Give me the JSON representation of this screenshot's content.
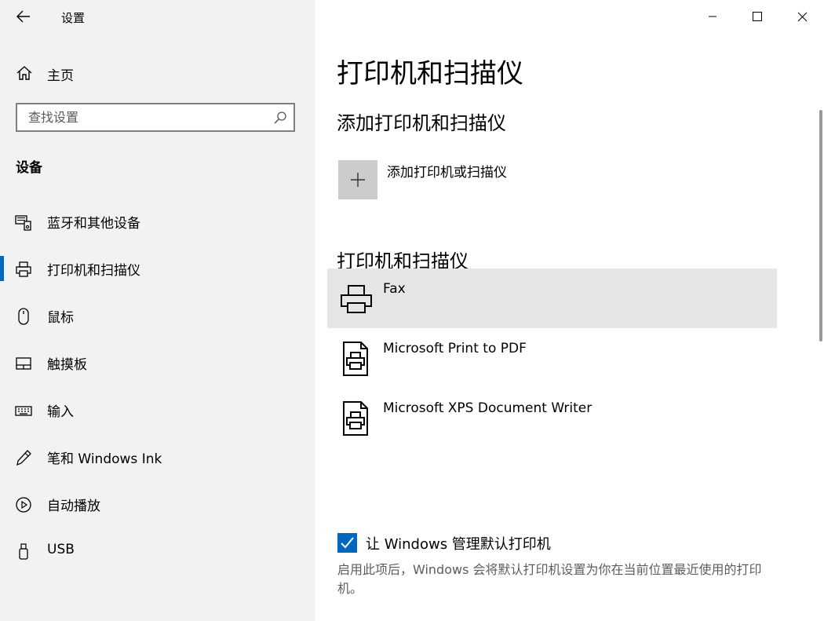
{
  "window": {
    "title": "设置",
    "controls": {
      "minimize": "minimize-icon",
      "maximize": "maximize-icon",
      "close": "close-icon"
    }
  },
  "sidebar": {
    "home_label": "主页",
    "search_placeholder": "查找设置",
    "section_title": "设备",
    "items": [
      {
        "label": "蓝牙和其他设备",
        "icon": "bluetooth-devices-icon"
      },
      {
        "label": "打印机和扫描仪",
        "icon": "printer-icon",
        "active": true
      },
      {
        "label": "鼠标",
        "icon": "mouse-icon"
      },
      {
        "label": "触摸板",
        "icon": "touchpad-icon"
      },
      {
        "label": "输入",
        "icon": "keyboard-icon"
      },
      {
        "label": "笔和 Windows Ink",
        "icon": "pen-icon"
      },
      {
        "label": "自动播放",
        "icon": "autoplay-icon"
      },
      {
        "label": "USB",
        "icon": "usb-icon"
      }
    ]
  },
  "main": {
    "page_title": "打印机和扫描仪",
    "add_section_title": "添加打印机和扫描仪",
    "add_button_label": "添加打印机或扫描仪",
    "list_title": "打印机和扫描仪",
    "printers": [
      {
        "name": "Fax",
        "selected": true,
        "icon": "printer-icon"
      },
      {
        "name": "Microsoft Print to PDF",
        "icon": "document-printer-icon"
      },
      {
        "name": "Microsoft XPS Document Writer",
        "icon": "document-printer-icon"
      }
    ],
    "default_printer": {
      "checked": true,
      "label": "让 Windows 管理默认打印机",
      "description": "启用此项后，Windows 会将默认打印机设置为你在当前位置最近使用的打印机。"
    }
  },
  "colors": {
    "accent": "#0067c0",
    "sidebar_bg": "#f2f2f2",
    "selected_bg": "#e6e6e6",
    "add_tile_bg": "#cccccc"
  }
}
